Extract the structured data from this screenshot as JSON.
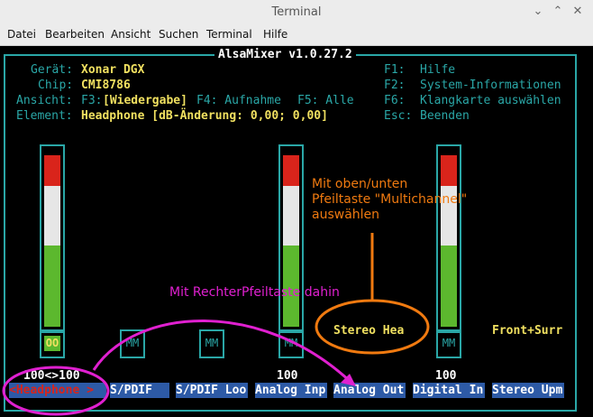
{
  "window": {
    "title": "Terminal"
  },
  "menu": [
    "Datei",
    "Bearbeiten",
    "Ansicht",
    "Suchen",
    "Terminal",
    "Hilfe"
  ],
  "alsamixer": {
    "header": "AlsaMixer v1.0.27.2",
    "geraet_label": "Gerät:",
    "geraet_value": "Xonar DGX",
    "chip_label": "Chip:",
    "chip_value": "CMI8786",
    "ansicht_label": "Ansicht:",
    "ansicht_f3": "F3:",
    "ansicht_value": "[Wiedergabe]",
    "ansicht_f4": "F4: Aufnahme",
    "ansicht_f5": "F5: Alle",
    "element_label": "Element:",
    "element_value": "Headphone [dB-Änderung: 0,00; 0,00]",
    "keys": [
      {
        "key": "F1:",
        "desc": "Hilfe"
      },
      {
        "key": "F2:",
        "desc": "System-Informationen"
      },
      {
        "key": "F6:",
        "desc": "Klangkarte auswählen"
      },
      {
        "key": "Esc:",
        "desc": "Beenden"
      }
    ],
    "headphone_mute": "OO",
    "headphone_volume": "100<>100",
    "mm": [
      "MM",
      "MM",
      "MM",
      "MM"
    ],
    "analog_out_volume": "100",
    "analog_out_name": "Stereo Hea",
    "digital_in_volume": "100",
    "front_surr": "Front+Surr",
    "channels": [
      "<Headphone >",
      "S/PDIF",
      "S/PDIF Loo",
      "Analog Inp",
      "Analog Out",
      "Digital In",
      "Stereo Upm"
    ]
  },
  "annotations": {
    "orange_line1": "Mit oben/unten",
    "orange_line2": "Pfeiltaste \"Multichannel\"",
    "orange_line3": "auswählen",
    "magenta": "Mit RechterPfeiltaste dahin"
  },
  "colors": {
    "teal": "#2aa7a7",
    "yellow": "#f0e060",
    "label_bg": "#2d5aa6",
    "orange": "#f07a10",
    "magenta": "#e020d0"
  }
}
